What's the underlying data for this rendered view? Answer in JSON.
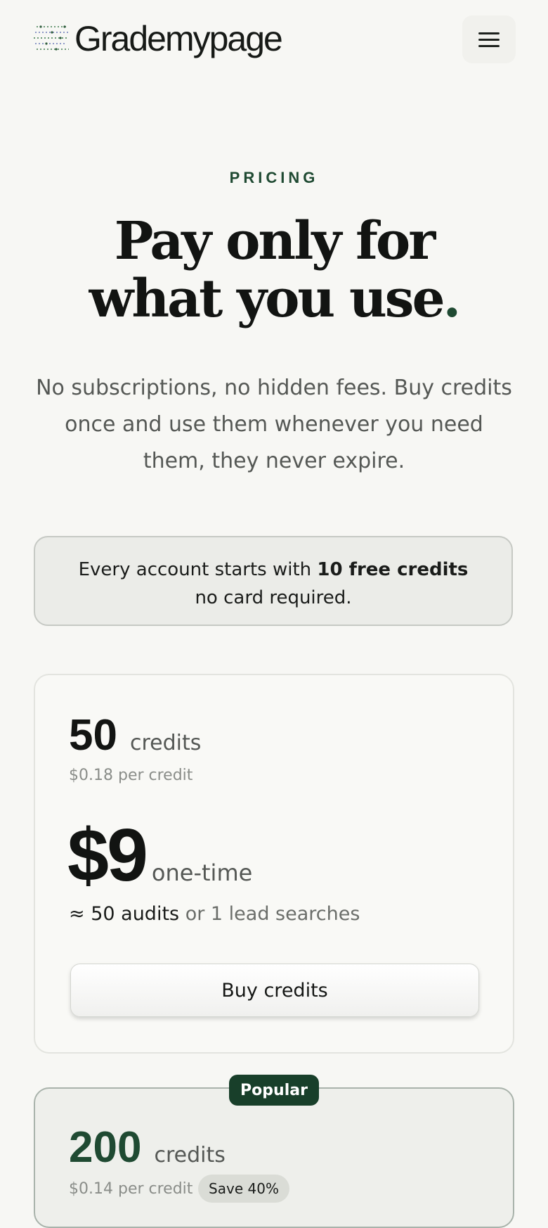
{
  "header": {
    "brand": "Grademypage",
    "menu_icon": "hamburger-menu-icon"
  },
  "hero": {
    "eyebrow": "PRICING",
    "headline_line1": "Pay only for",
    "headline_line2": "what you use",
    "headline_dot": ".",
    "subtext": "No subscriptions, no hidden fees. Buy credits once and use them whenever you need them, they never expire."
  },
  "notice": {
    "prefix": "Every account starts with ",
    "highlight": "10 free credits",
    "suffix": "no card required."
  },
  "plans": [
    {
      "credits": "50",
      "unit": "credits",
      "per_credit": "$0.18 per credit",
      "price": "$9",
      "price_note": "one-time",
      "usage_approx": "≈ 50 audits",
      "usage_or": " or 1 lead searches",
      "button": "Buy credits"
    },
    {
      "badge": "Popular",
      "credits": "200",
      "unit": "credits",
      "per_credit": "$0.14 per credit",
      "save": "Save 40%"
    }
  ],
  "colors": {
    "accent": "#1f4a32",
    "background": "#f7f7f4"
  }
}
